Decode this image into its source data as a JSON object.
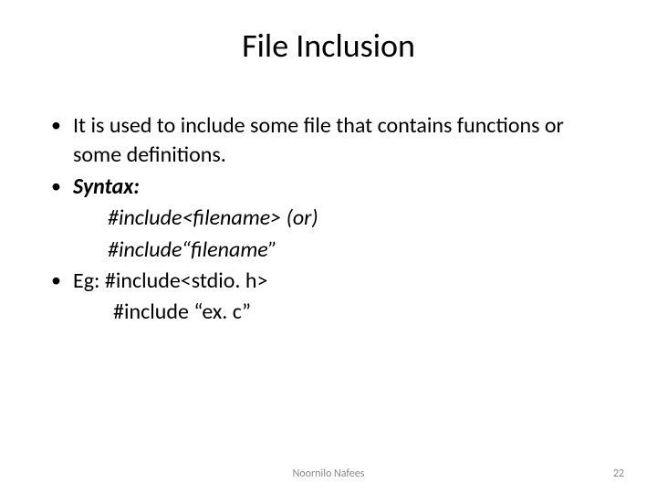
{
  "title": "File Inclusion",
  "bullets": {
    "b1": "It is used to include some file that contains functions or some definitions.",
    "b2_label": "Syntax:",
    "b2_line1": "#include<filename>   (or)",
    "b2_line2": "#include“filename”",
    "b3_prefix": "Eg: ",
    "b3_code": "#include<stdio. h>",
    "b3_line2": "#include “ex. c”"
  },
  "footer": {
    "author": "Noornilo Nafees",
    "page": "22"
  }
}
